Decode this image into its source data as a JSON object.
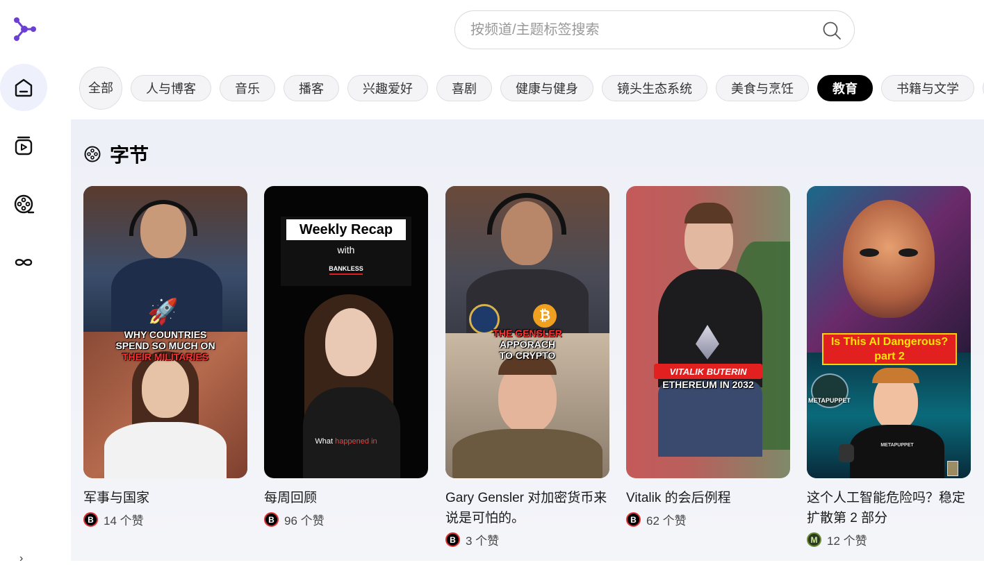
{
  "search": {
    "placeholder": "按频道/主题标签搜索"
  },
  "nav": [
    {
      "name": "home",
      "icon": "home-icon"
    },
    {
      "name": "video-stack",
      "icon": "video-stack-icon"
    },
    {
      "name": "film-reel",
      "icon": "film-reel-icon"
    },
    {
      "name": "infinity",
      "icon": "infinity-icon"
    }
  ],
  "tags": [
    "全部",
    "人与博客",
    "音乐",
    "播客",
    "兴趣爱好",
    "喜剧",
    "健康与健身",
    "镜头生态系统",
    "美食与烹饪",
    "教育",
    "书籍与文学"
  ],
  "active_tag": "教育",
  "section": {
    "title": "字节"
  },
  "cards": [
    {
      "title": "军事与国家",
      "likes": "14 个赞",
      "avatar": "B",
      "overlay_line1": "WHY COUNTRIES",
      "overlay_line2": "SPEND SO MUCH ON",
      "overlay_line3": "THEIR MILITARIES"
    },
    {
      "title": "每周回顾",
      "likes": "96 个赞",
      "avatar": "B",
      "box_title": "Weekly Recap",
      "box_with": "with",
      "box_brand": "BANKLESS",
      "caption_a": "What ",
      "caption_b": "happened in"
    },
    {
      "title": "Gary Gensler 对加密货币来说是可怕的。",
      "likes": "3 个赞",
      "avatar": "B",
      "overlay_line1": "THE GENSLER",
      "overlay_line2": "APPORACH",
      "overlay_line3": "TO CRYPTO"
    },
    {
      "title": "Vitalik 的会后例程",
      "likes": "62 个赞",
      "avatar": "B",
      "banner_red": "VITALIK BUTERIN",
      "banner_sub": "ETHEREUM IN 2032"
    },
    {
      "title": "这个人工智能危险吗？稳定扩散第 2 部分",
      "likes": "12 个赞",
      "avatar": "M",
      "banner_line1": "Is This AI Dangerous?",
      "banner_line2": "part 2",
      "brand": "METAPUPPET",
      "shirt": "METAPUPPET"
    }
  ],
  "colors": {
    "accent": "#6b3fd4",
    "active_tag_bg": "#000000",
    "nav_active_bg": "#eef0fb"
  }
}
